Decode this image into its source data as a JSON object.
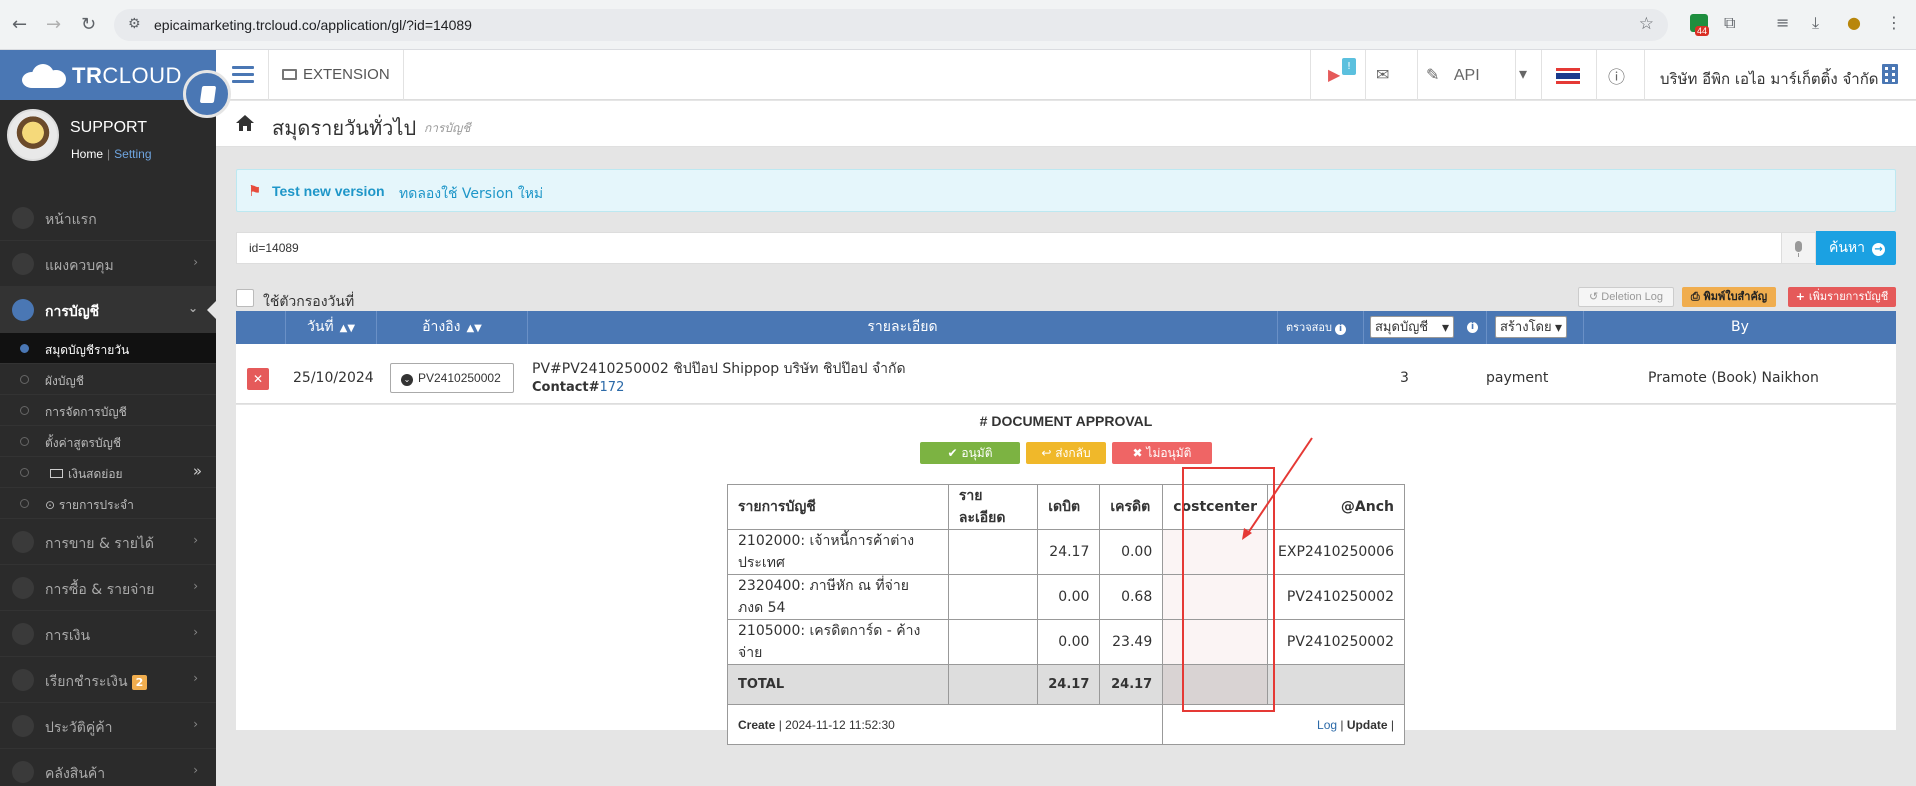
{
  "browser": {
    "url": "epicaimarketing.trcloud.co/application/gl/?id=14089",
    "ext_badge": "44"
  },
  "sidebar": {
    "brand_tr": "TR",
    "brand_cloud": "CLOUD",
    "username": "SUPPORT",
    "home_link": "Home",
    "setting_link": "Setting",
    "menu": [
      {
        "label": "หน้าแรก"
      },
      {
        "label": "แผงควบคุม"
      },
      {
        "label": "การบัญชี"
      },
      {
        "label": "การขาย & รายได้"
      },
      {
        "label": "การซื้อ & รายจ่าย"
      },
      {
        "label": "การเงิน"
      },
      {
        "label": "เรียกชำระเงิน",
        "badge": "2"
      },
      {
        "label": "ประวัติคู่ค้า"
      },
      {
        "label": "คลังสินค้า"
      }
    ],
    "submenu": [
      {
        "label": "สมุดบัญชีรายวัน"
      },
      {
        "label": "ผังบัญชี"
      },
      {
        "label": "การจัดการบัญชี"
      },
      {
        "label": "ตั้งค่าสูตรบัญชี"
      },
      {
        "label": "เงินสดย่อย"
      },
      {
        "label": "รายการประจำ"
      }
    ]
  },
  "topbar": {
    "extension": "EXTENSION",
    "notif_count": "!",
    "api": "API",
    "company": "บริษัท อีพิก เอไอ มาร์เก็ตติ้ง จำกัด"
  },
  "page": {
    "title": "สมุดรายวันทั่วไป",
    "subtitle": "การบัญชี"
  },
  "alert": {
    "title": "Test new version",
    "text": "ทดลองใช้ Version ใหม่"
  },
  "search": {
    "value": "id=14089",
    "button": "ค้นหา"
  },
  "filter": {
    "checkbox_label": "ใช้ตัวกรองวันที่",
    "deletion_log": "Deletion Log",
    "print": "พิมพ์ใบสำคัญ",
    "add": "เพิ่มรายการบัญชี"
  },
  "list": {
    "headers": {
      "date": "วันที่",
      "ref": "อ้างอิง",
      "desc": "รายละเอียด",
      "check": "ตรวจสอบ",
      "book_select": "สมุดบัญชี",
      "created_select": "สร้างโดย",
      "by": "By"
    },
    "row": {
      "date": "25/10/2024",
      "ref": "PV2410250002",
      "desc": "PV#PV2410250002 ชิปป๊อป Shippop บริษัท ชิปป๊อป จำกัด",
      "contact_label": "Contact#",
      "contact_num": "172",
      "check": "3",
      "book": "payment",
      "by": "Pramote (Book) Naikhon"
    }
  },
  "approval": {
    "title": "# DOCUMENT APPROVAL",
    "approve": "อนุมัติ",
    "return": "ส่งกลับ",
    "reject": "ไม่อนุมัติ"
  },
  "detail": {
    "headers": [
      "รายการบัญชี",
      "รายละเอียด",
      "เดบิต",
      "เครดิต",
      "costcenter",
      "@Anch"
    ],
    "rows": [
      {
        "account": "2102000: เจ้าหนี้การค้าต่างประเทศ",
        "desc": "",
        "debit": "24.17",
        "credit": "0.00",
        "cc": "",
        "anch": "EXP2410250006"
      },
      {
        "account": "2320400: ภาษีหัก ณ ที่จ่าย ภงด 54",
        "desc": "",
        "debit": "0.00",
        "credit": "0.68",
        "cc": "",
        "anch": "PV2410250002"
      },
      {
        "account": "2105000: เครดิตการ์ด - ค้างจ่าย",
        "desc": "",
        "debit": "0.00",
        "credit": "23.49",
        "cc": "",
        "anch": "PV2410250002"
      }
    ],
    "total_label": "TOTAL",
    "total_debit": "24.17",
    "total_credit": "24.17",
    "create_label": "Create",
    "create_time": "| 2024-11-12 11:52:30",
    "log": "Log",
    "update": "Update"
  },
  "colors": {
    "brand": "#4a77b4",
    "highlight": "#e53935"
  }
}
